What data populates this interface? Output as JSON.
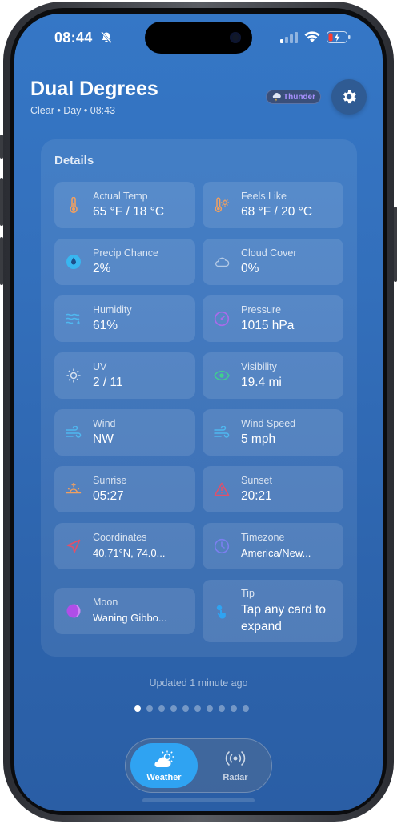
{
  "status_bar": {
    "time": "08:44"
  },
  "header": {
    "title": "Dual Degrees",
    "subtitle": "Clear • Day • 08:43",
    "badge_label": "Thunder",
    "badge_color": "#a991ff"
  },
  "details": {
    "title": "Details",
    "cards": [
      {
        "label": "Actual Temp",
        "value": "65 °F / 18 °C",
        "icon": "thermometer-icon"
      },
      {
        "label": "Feels Like",
        "value": "68 °F / 20 °C",
        "icon": "thermometer-sun-icon"
      },
      {
        "label": "Precip Chance",
        "value": "2%",
        "icon": "droplet-icon"
      },
      {
        "label": "Cloud Cover",
        "value": "0%",
        "icon": "cloud-icon"
      },
      {
        "label": "Humidity",
        "value": "61%",
        "icon": "humidity-icon"
      },
      {
        "label": "Pressure",
        "value": "1015 hPa",
        "icon": "gauge-icon"
      },
      {
        "label": "UV",
        "value": "2 / 11",
        "icon": "sun-icon"
      },
      {
        "label": "Visibility",
        "value": "19.4 mi",
        "icon": "eye-icon"
      },
      {
        "label": "Wind",
        "value": "NW",
        "icon": "wind-icon"
      },
      {
        "label": "Wind Speed",
        "value": "5 mph",
        "icon": "wind-speed-icon"
      },
      {
        "label": "Sunrise",
        "value": "05:27",
        "icon": "sunrise-icon"
      },
      {
        "label": "Sunset",
        "value": "20:21",
        "icon": "sunset-icon"
      },
      {
        "label": "Coordinates",
        "value": "40.71°N, 74.0...",
        "icon": "location-arrow-icon"
      },
      {
        "label": "Timezone",
        "value": "America/New...",
        "icon": "clock-icon"
      },
      {
        "label": "Moon",
        "value": "Waning Gibbo...",
        "icon": "moon-icon"
      },
      {
        "label": "Tip",
        "value": "Tap any card to expand",
        "icon": "tap-icon"
      }
    ]
  },
  "footer": {
    "updated": "Updated 1 minute ago"
  },
  "pager": {
    "count": 10,
    "active": 0
  },
  "tabbar": {
    "weather_label": "Weather",
    "radar_label": "Radar",
    "active": "weather"
  },
  "colors": {
    "accent": "#2fa3f2",
    "background": "#3577c6"
  }
}
